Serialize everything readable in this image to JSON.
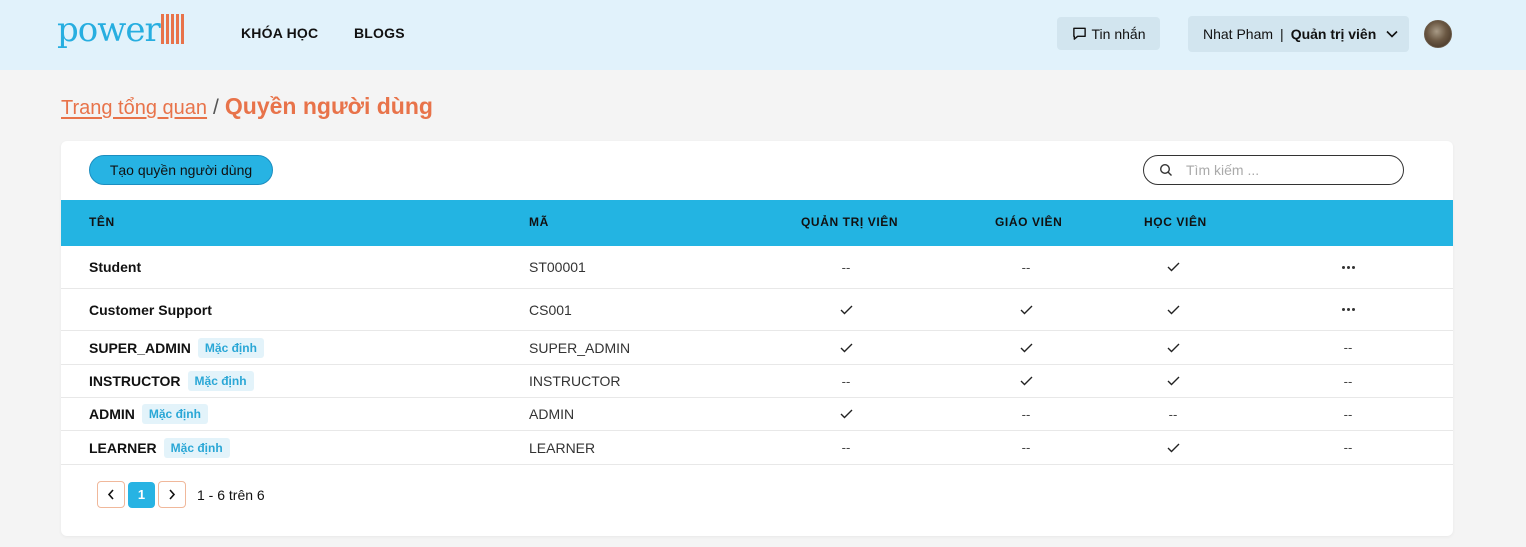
{
  "brand": {
    "logo_text": "power",
    "accent": "#e8734a",
    "primary": "#27b3e3"
  },
  "nav": {
    "courses": "KHÓA HỌC",
    "blogs": "BLOGS"
  },
  "header": {
    "messages_label": "Tin nhắn",
    "user_name": "Nhat Pham",
    "separator": "|",
    "user_role": "Quản trị viên"
  },
  "breadcrumb": {
    "parent": "Trang tổng quan",
    "separator": "/",
    "current": "Quyền người dùng"
  },
  "toolbar": {
    "create_label": "Tạo quyền người dùng",
    "search_placeholder": "Tìm kiếm ..."
  },
  "table": {
    "columns": [
      "TÊN",
      "MÃ",
      "QUẢN TRỊ VIÊN",
      "GIÁO VIÊN",
      "HỌC VIÊN"
    ],
    "default_badge": "Mặc định",
    "dash": "--",
    "rows": [
      {
        "name": "Student",
        "code": "ST00001",
        "badge": "",
        "admin": false,
        "instructor": false,
        "learner": true,
        "actions": true
      },
      {
        "name": "Customer Support",
        "code": "CS001",
        "badge": "",
        "admin": true,
        "instructor": true,
        "learner": true,
        "actions": true
      },
      {
        "name": "SUPER_ADMIN",
        "code": "SUPER_ADMIN",
        "badge": "Mặc định",
        "admin": true,
        "instructor": true,
        "learner": true,
        "actions": false
      },
      {
        "name": "INSTRUCTOR",
        "code": "INSTRUCTOR",
        "badge": "Mặc định",
        "admin": false,
        "instructor": true,
        "learner": true,
        "actions": false
      },
      {
        "name": "ADMIN",
        "code": "ADMIN",
        "badge": "Mặc định",
        "admin": true,
        "instructor": false,
        "learner": false,
        "actions": false
      },
      {
        "name": "LEARNER",
        "code": "LEARNER",
        "badge": "Mặc định",
        "admin": false,
        "instructor": false,
        "learner": true,
        "actions": false
      }
    ]
  },
  "pagination": {
    "current_page": "1",
    "summary": "1 - 6 trên 6"
  }
}
